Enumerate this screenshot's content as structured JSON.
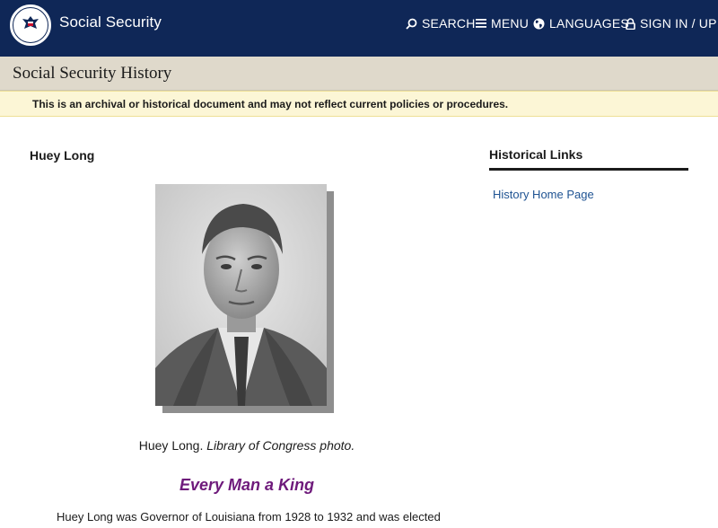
{
  "header": {
    "brand": "Social Security",
    "nav": {
      "search": "SEARCH",
      "menu": "MENU",
      "languages": "LANGUAGES",
      "sign_in": "SIGN IN / UP"
    }
  },
  "history_bar": {
    "title": "Social Security History"
  },
  "notice": {
    "text": "This is an archival or historical document and may not reflect current policies or procedures."
  },
  "main": {
    "title": "Huey Long",
    "caption_name": "Huey Long. ",
    "caption_credit": "Library of Congress photo.",
    "quote": "Every Man a King",
    "paragraph": "Huey Long was Governor of Louisiana from 1928 to 1932 and was elected"
  },
  "sidebar": {
    "title": "Historical Links",
    "links": [
      "History Home Page"
    ]
  },
  "colors": {
    "header_bg": "#0f2757",
    "history_bar_bg": "#dfd9cb",
    "notice_bg": "#fcf6d6",
    "link": "#205493",
    "quote": "#6e1a7b"
  },
  "icons": [
    "ssa-seal-logo",
    "search-icon",
    "menu-icon",
    "globe-icon",
    "lock-icon"
  ]
}
